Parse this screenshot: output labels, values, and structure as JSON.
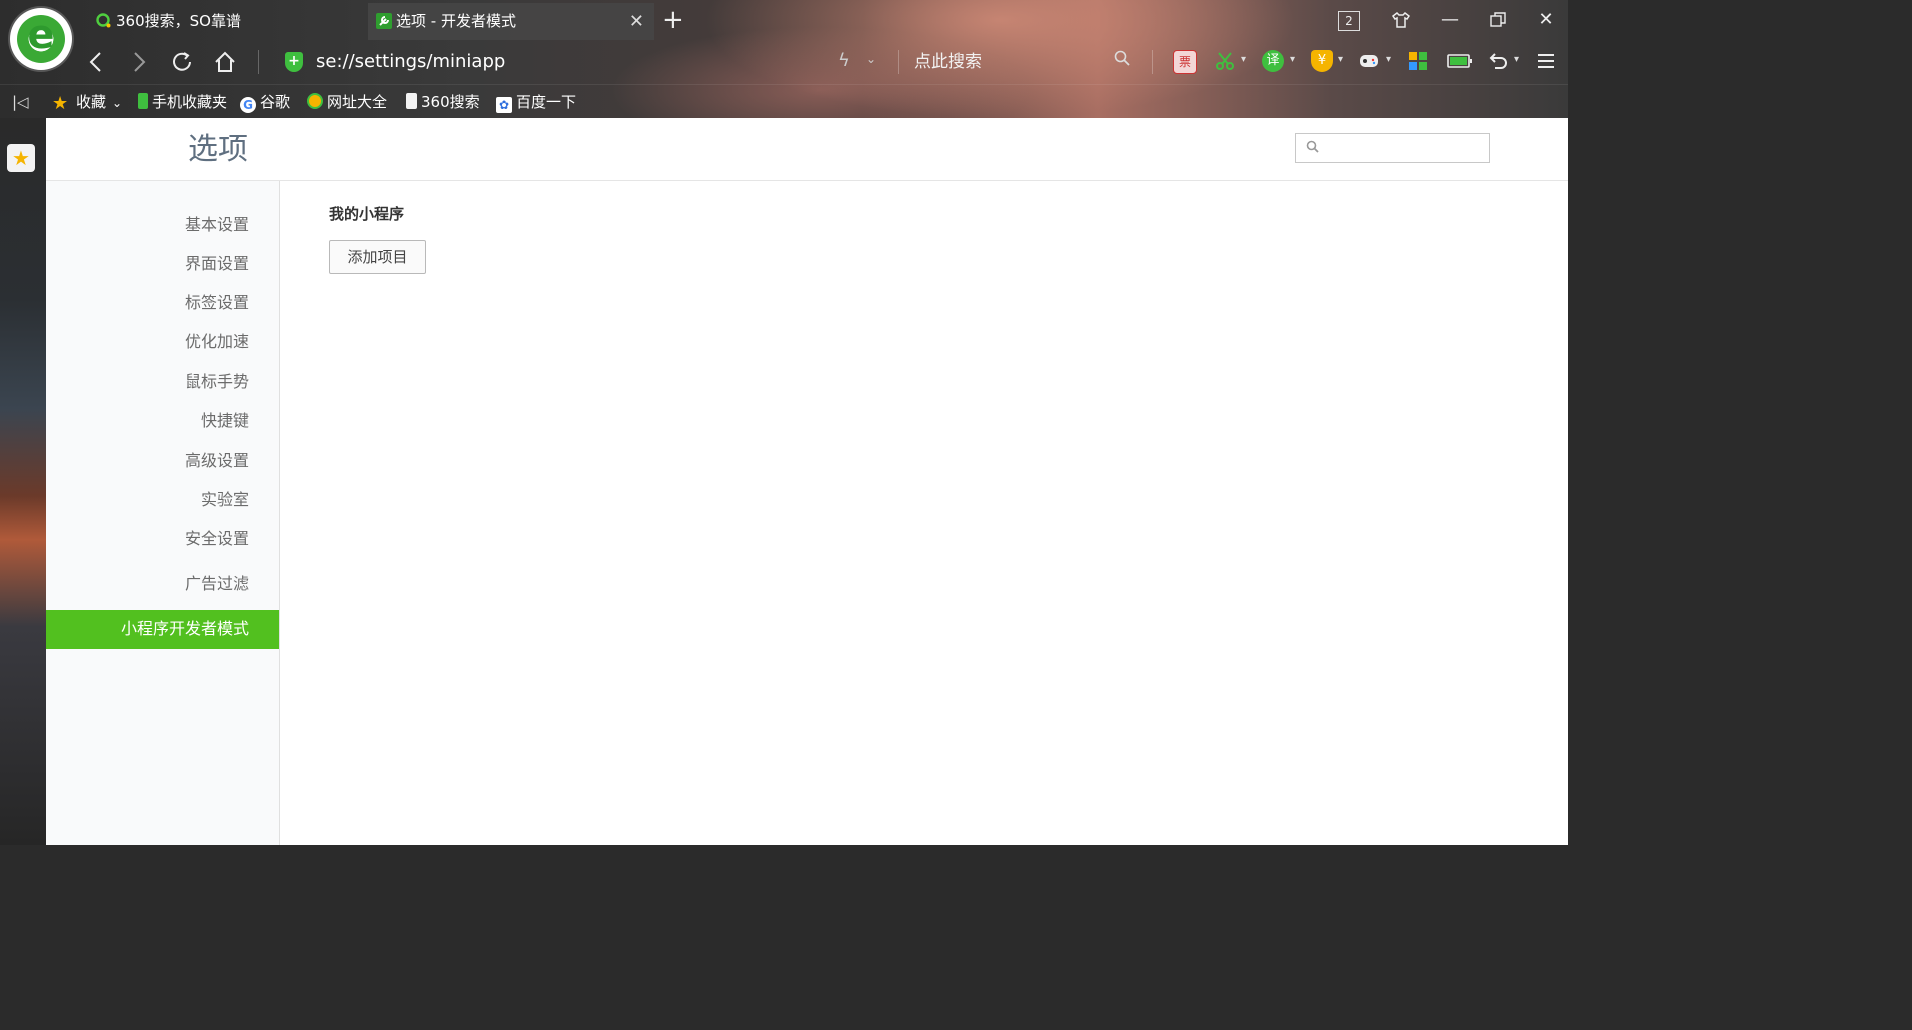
{
  "tabs": [
    {
      "label": "360搜索，SO靠谱",
      "active": false
    },
    {
      "label": "选项 - 开发者模式",
      "active": true
    }
  ],
  "window": {
    "tab_count": "2"
  },
  "address_bar": {
    "url": "se://settings/miniapp",
    "search_placeholder": "点此搜索"
  },
  "bookmarks": [
    {
      "label": "收藏",
      "icon": "star-icon"
    },
    {
      "label": "手机收藏夹",
      "icon": "phone-icon"
    },
    {
      "label": "谷歌",
      "icon": "google-icon"
    },
    {
      "label": "网址大全",
      "icon": "site-nav-icon"
    },
    {
      "label": "360搜索",
      "icon": "file-icon"
    },
    {
      "label": "百度一下",
      "icon": "baidu-paw-icon"
    }
  ],
  "toolbar": {
    "ticket_label": "票",
    "translate_label": "译",
    "coupon_label": "¥"
  },
  "page": {
    "title": "选项",
    "search_placeholder": ""
  },
  "sidebar": {
    "items": [
      {
        "label": "基本设置"
      },
      {
        "label": "界面设置"
      },
      {
        "label": "标签设置"
      },
      {
        "label": "优化加速"
      },
      {
        "label": "鼠标手势"
      },
      {
        "label": "快捷键"
      },
      {
        "label": "高级设置"
      },
      {
        "label": "实验室"
      },
      {
        "label": "安全设置"
      },
      {
        "label": "广告过滤"
      }
    ],
    "active_label": "小程序开发者模式"
  },
  "content": {
    "section_title": "我的小程序",
    "add_button": "添加项目"
  },
  "colors": {
    "accent": "#52c01f",
    "title": "#5f6f80"
  }
}
